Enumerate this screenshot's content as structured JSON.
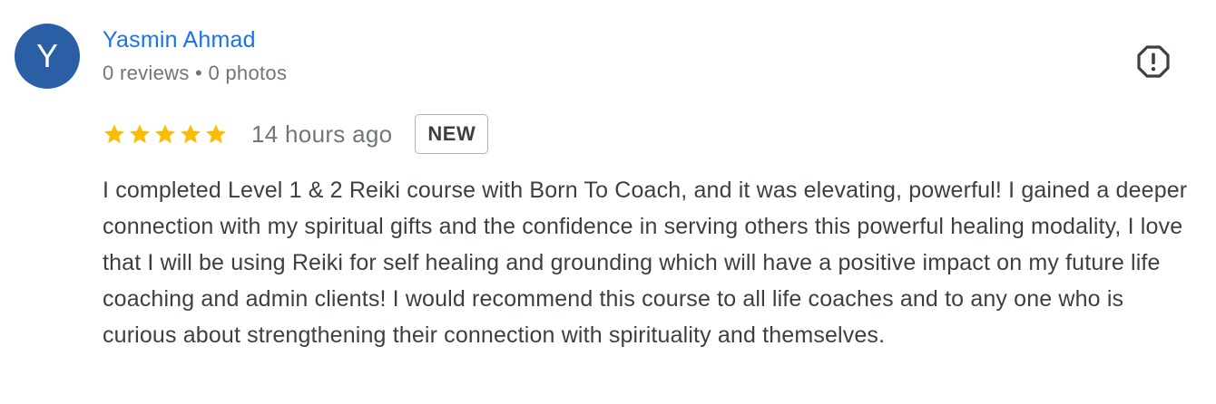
{
  "reviewer": {
    "initial": "Y",
    "name": "Yasmin Ahmad",
    "meta": "0 reviews • 0 photos",
    "avatar_color": "#2b5fa5"
  },
  "review": {
    "rating": 5,
    "max_rating": 5,
    "star_color": "#fbbc04",
    "time_ago": "14 hours ago",
    "badge": "NEW",
    "text": "I completed Level 1 & 2 Reiki course with Born To Coach, and it was elevating, powerful! I gained a deeper connection with my spiritual gifts and the confidence in serving others this powerful healing modality, I love that I will be using Reiki for self healing and grounding which will have a positive impact on my future life coaching and admin clients! I would recommend this course to all life coaches and to any one who is curious about strengthening their connection with spirituality and themselves."
  },
  "actions": {
    "report_icon": "report-flag-octagon-icon"
  }
}
